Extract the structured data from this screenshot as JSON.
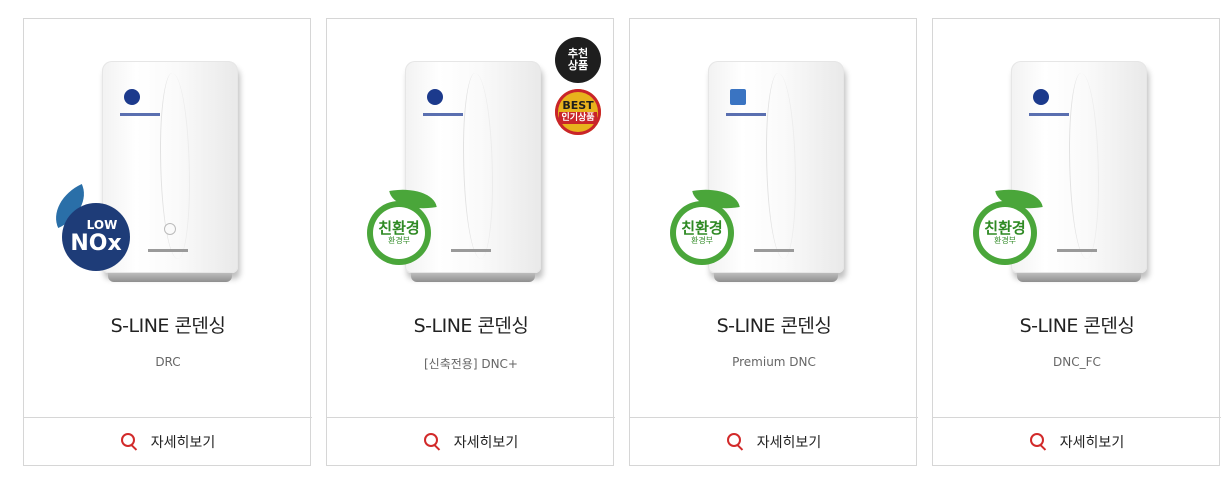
{
  "products": [
    {
      "title": "S-LINE 콘덴싱",
      "model": "DRC",
      "badge": {
        "low": "LOW",
        "main": "NOx"
      },
      "detail_label": "자세히보기"
    },
    {
      "title": "S-LINE 콘덴싱",
      "model": "[신축전용] DNC+",
      "eco": {
        "main": "친환경",
        "sub": "환경부"
      },
      "recommend": {
        "line1": "추천",
        "line2": "상품"
      },
      "best": {
        "top": "BEST",
        "bottom": "인기상품"
      },
      "detail_label": "자세히보기"
    },
    {
      "title": "S-LINE 콘덴싱",
      "model": "Premium DNC",
      "eco": {
        "main": "친환경",
        "sub": "환경부"
      },
      "detail_label": "자세히보기"
    },
    {
      "title": "S-LINE 콘덴싱",
      "model": "DNC_FC",
      "eco": {
        "main": "친환경",
        "sub": "환경부"
      },
      "detail_label": "자세히보기"
    }
  ],
  "colors": {
    "accent": "#d22a2a",
    "eco_green": "#4aa63a",
    "nox_blue": "#1e3c78",
    "border": "#d6d6d6"
  },
  "icons": {
    "detail": "search-icon"
  }
}
